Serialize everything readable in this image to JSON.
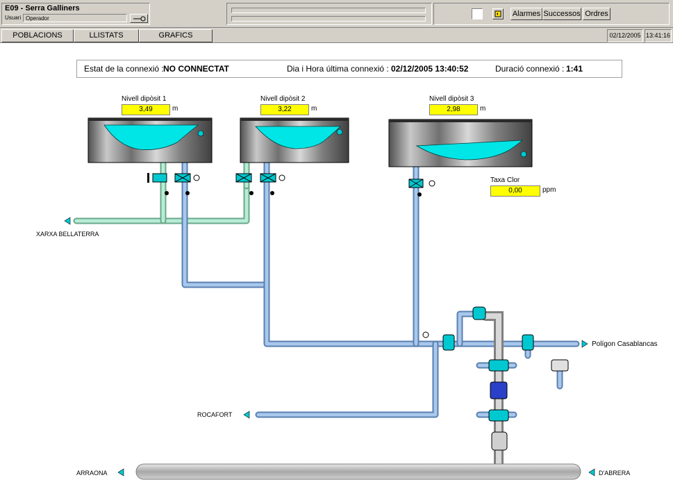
{
  "header": {
    "title": "E09 - Serra Galliners",
    "user_label": "Usuari",
    "user_value": "Operador",
    "buttons": {
      "alarms": "Alarmes",
      "events": "Successos",
      "orders": "Ordres"
    }
  },
  "nav": {
    "tabs": [
      "POBLACIONS",
      "LLISTATS",
      "GRAFICS"
    ],
    "date": "02/12/2005",
    "time": "13:41:16"
  },
  "status": {
    "connection_label": "Estat de la connexió :",
    "connection_value": "NO CONNECTAT",
    "last_label": "Dia i Hora última connexió :",
    "last_value": "02/12/2005 13:40:52",
    "duration_label": "Duració connexió :",
    "duration_value": "1:41"
  },
  "tanks": [
    {
      "label": "Nivell dipòsit 1",
      "value": "3,49",
      "unit": "m",
      "level": 0.55
    },
    {
      "label": "Nivell dipòsit 2",
      "value": "3,22",
      "unit": "m",
      "level": 0.5
    },
    {
      "label": "Nivell dipòsit 3",
      "value": "2,98",
      "unit": "m",
      "level": 0.35
    }
  ],
  "chlorine": {
    "label": "Taxa Clor",
    "value": "0,00",
    "unit": "ppm"
  },
  "destinations": {
    "bellaterra": "XARXA BELLATERRA",
    "casablancas": "Polígon Casablancas",
    "rocafort": "ROCAFORT",
    "arraona": "ARRAONA",
    "dabrera": "D'ABRERA"
  },
  "colors": {
    "water": "#00e5e5",
    "pipe_blue": "#8fb3df",
    "pipe_green": "#a8e0c8",
    "pipe_gray": "#c0c0c0",
    "valve": "#00c8d0",
    "yellow": "#ffff00"
  }
}
